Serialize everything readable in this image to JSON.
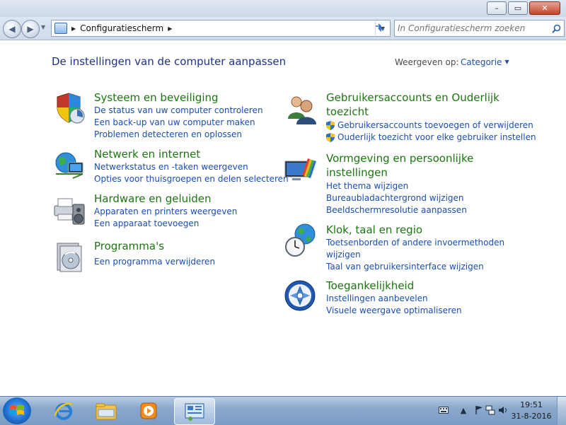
{
  "window": {
    "minimize_glyph": "–",
    "maximize_glyph": "▭",
    "close_glyph": "✕"
  },
  "navigation": {
    "breadcrumb": "Configuratiescherm",
    "search_placeholder": "In Configuratiescherm zoeken"
  },
  "header": {
    "title": "De instellingen van de computer aanpassen",
    "view_label": "Weergeven op:",
    "view_value": "Categorie"
  },
  "categories_left": [
    {
      "icon": "shield-security-icon",
      "title": "Systeem en beveiliging",
      "links": [
        {
          "label": "De status van uw computer controleren",
          "shield": false
        },
        {
          "label": "Een back-up van uw computer maken",
          "shield": false
        },
        {
          "label": "Problemen detecteren en oplossen",
          "shield": false
        }
      ]
    },
    {
      "icon": "network-globe-icon",
      "title": "Netwerk en internet",
      "links": [
        {
          "label": "Netwerkstatus en -taken weergeven",
          "shield": false
        },
        {
          "label": "Opties voor thuisgroepen en delen selecteren",
          "shield": false
        }
      ]
    },
    {
      "icon": "printer-speaker-icon",
      "title": "Hardware en geluiden",
      "links": [
        {
          "label": "Apparaten en printers weergeven",
          "shield": false
        },
        {
          "label": "Een apparaat toevoegen",
          "shield": false
        }
      ]
    },
    {
      "icon": "programs-disc-icon",
      "title": "Programma's",
      "links": [
        {
          "label": "Een programma verwijderen",
          "shield": false
        }
      ]
    }
  ],
  "categories_right": [
    {
      "icon": "users-icon",
      "title_line1": "Gebruikersaccounts en Ouderlijk",
      "title_line2": "toezicht",
      "links": [
        {
          "label": "Gebruikersaccounts toevoegen of verwijderen",
          "shield": true
        },
        {
          "label": "Ouderlijk toezicht voor elke gebruiker instellen",
          "shield": true
        }
      ]
    },
    {
      "icon": "appearance-monitor-icon",
      "title_line1": "Vormgeving en persoonlijke",
      "title_line2": "instellingen",
      "links": [
        {
          "label": "Het thema wijzigen",
          "shield": false
        },
        {
          "label": "Bureaubladachtergrond wijzigen",
          "shield": false
        },
        {
          "label": "Beeldschermresolutie aanpassen",
          "shield": false
        }
      ]
    },
    {
      "icon": "clock-globe-icon",
      "title_line1": "Klok, taal en regio",
      "links": [
        {
          "label": "Toetsenborden of andere invoermethoden",
          "label2": "wijzigen",
          "shield": false
        },
        {
          "label": "Taal van gebruikersinterface wijzigen",
          "shield": false
        }
      ]
    },
    {
      "icon": "accessibility-icon",
      "title_line1": "Toegankelijkheid",
      "links": [
        {
          "label": "Instellingen aanbevelen",
          "shield": false
        },
        {
          "label": "Visuele weergave optimaliseren",
          "shield": false
        }
      ]
    }
  ],
  "taskbar": {
    "pinned": [
      "internet-explorer-icon",
      "windows-explorer-icon",
      "media-player-icon",
      "control-panel-icon"
    ],
    "active": "control-panel-icon",
    "clock_time": "19:51",
    "clock_date": "31-8-2016"
  },
  "colors": {
    "title_blue": "#1e3287",
    "category_green": "#1d7512",
    "link_blue": "#1a4eb0"
  }
}
